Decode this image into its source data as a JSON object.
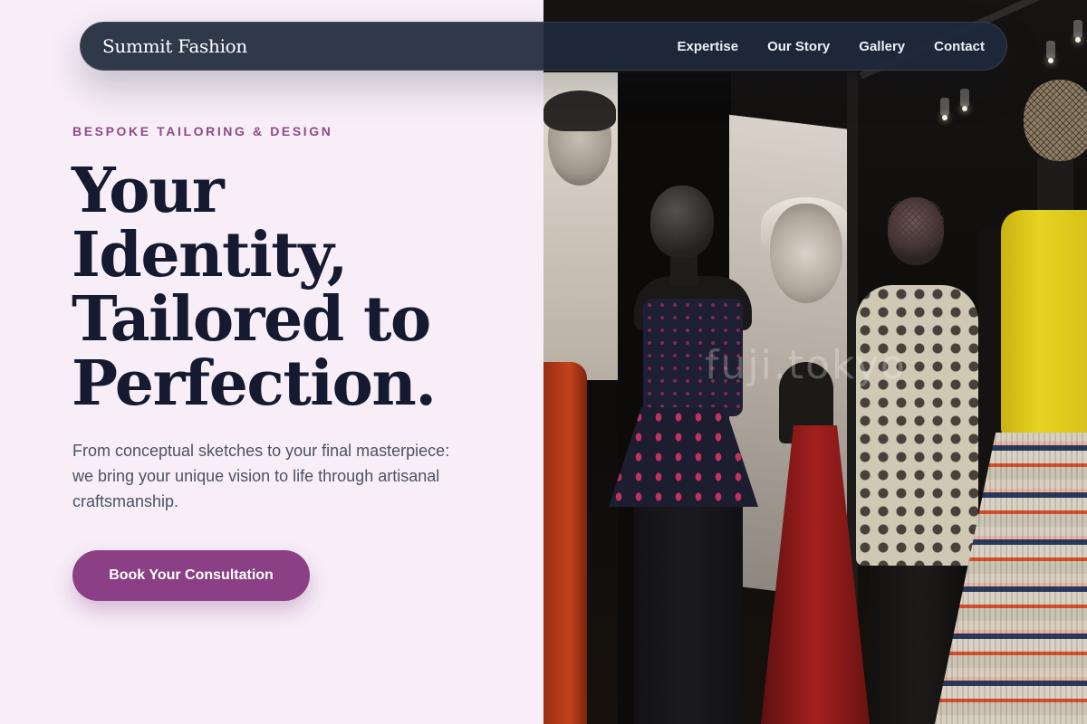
{
  "nav": {
    "brand": "Summit Fashion",
    "links": [
      "Expertise",
      "Our Story",
      "Gallery",
      "Contact"
    ]
  },
  "hero": {
    "eyebrow": "BESPOKE TAILORING & DESIGN",
    "headline_lines": [
      "Your",
      "Identity,",
      "Tailored to",
      "Perfection."
    ],
    "subtext": "From conceptual sketches to your final masterpiece: we bring your unique vision to life through artisanal craftsmanship.",
    "cta_label": "Book Your Consultation"
  },
  "image": {
    "watermark": "fuji.tokyo"
  },
  "colors": {
    "accent": "#8b3f84",
    "eyebrow": "#8e4a87",
    "headline": "#151a30",
    "background": "#f7eef7",
    "navbar": "#1e293b"
  }
}
